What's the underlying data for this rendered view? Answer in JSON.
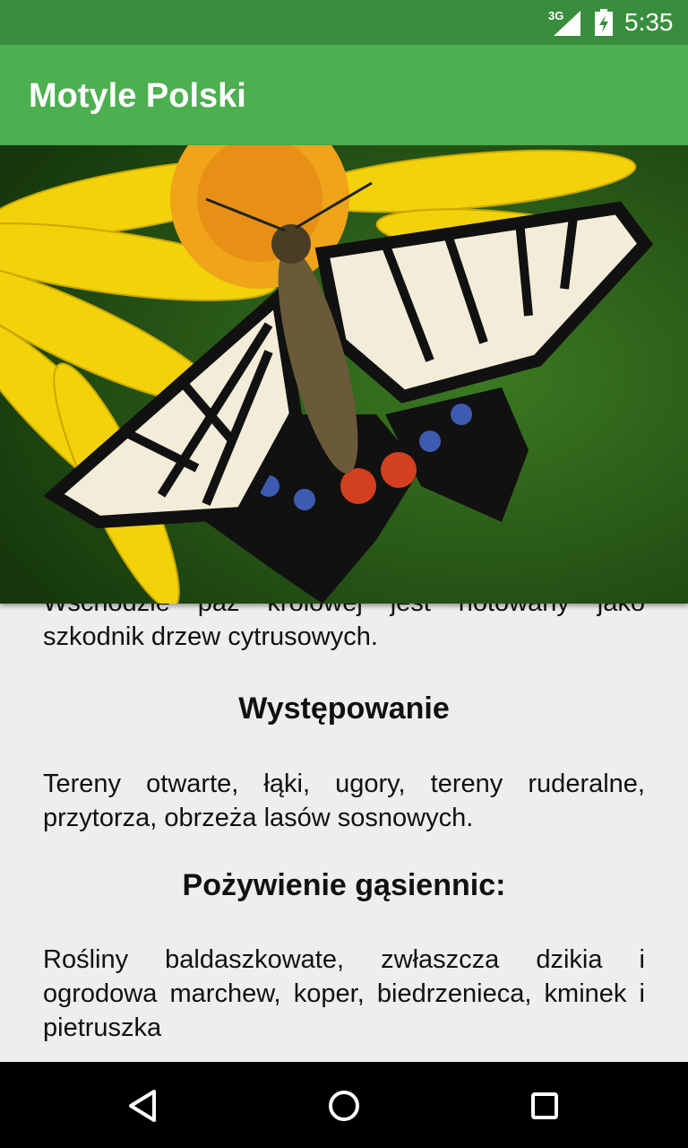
{
  "status_bar": {
    "network": "3G",
    "time": "5:35"
  },
  "app_bar": {
    "title": "Motyle Polski"
  },
  "hero_image": {
    "subject": "swallowtail butterfly on yellow flower",
    "colors": {
      "background": "#1f4f12",
      "petals": "#f2d20a",
      "center": "#f0a41a",
      "wing_cream": "#f3ecd8",
      "wing_black": "#111111",
      "spot_blue": "#3d5bb0",
      "spot_red": "#d2401f"
    }
  },
  "content": {
    "partial_paragraph": "Wschodzie paź królowej jest notowany jako szkodnik drzew cytrusowych.",
    "sections": [
      {
        "heading": "Występowanie",
        "text": "Tereny otwarte, łąki, ugory, tereny ruderalne, przytorza, obrzeża lasów sosnowych."
      },
      {
        "heading": "Pożywienie gąsiennic:",
        "text": "Rośliny baldaszkowate, zwłaszcza dzikia i ogrodowa marchew, koper, biedrzenieca, kminek i pietruszka"
      }
    ]
  },
  "nav_bar": {
    "back_icon": "back-triangle-icon",
    "home_icon": "home-circle-icon",
    "recents_icon": "recents-square-icon"
  }
}
